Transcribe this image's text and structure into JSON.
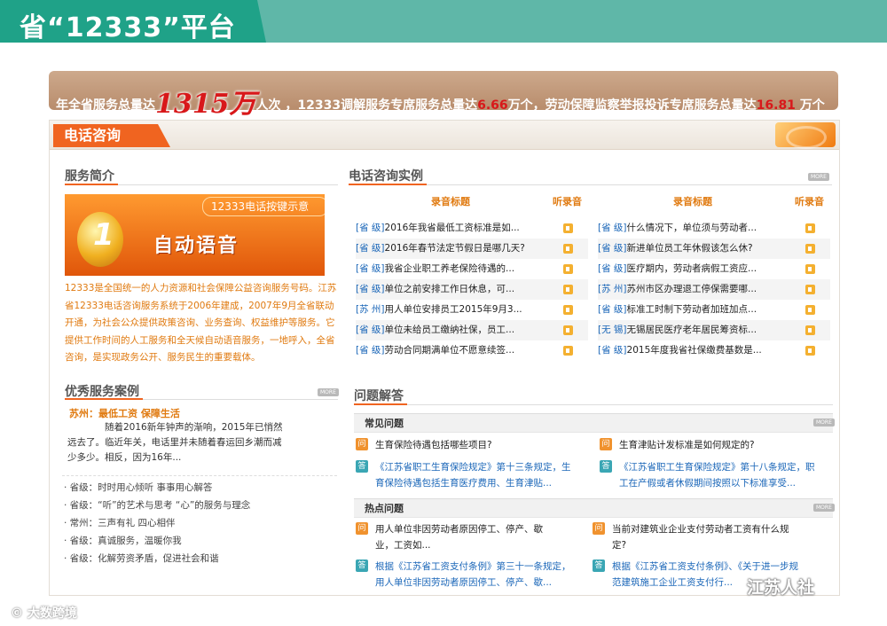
{
  "header": {
    "title": "省“12333”平台"
  },
  "stats": {
    "prefix": "年全省服务总量达",
    "total": "1315万",
    "part2": "人次 ，12333调解服务专席服务总量达",
    "mediation": "6.66",
    "part3": "万个，劳动保障监察举报投诉专席服务总量达",
    "complaints": "16.81",
    "part4": " 万个"
  },
  "panel": {
    "tab_label": "电话咨询"
  },
  "service_intro": {
    "title": "服务简介",
    "promo_top": "12333电话按键示意",
    "promo_main": "自动语音",
    "promo_number": "1",
    "text": "12333是全国统一的人力资源和社会保障公益咨询服务号码。江苏省12333电话咨询服务系统于2006年建成，2007年9月全省联动开通，为社会公众提供政策咨询、业务查询、权益维护等服务。它提供工作时间的人工服务和全天候自动语音服务，一地呼入，全省咨询，是实现政务公开、服务民生的重要载体。"
  },
  "cases": {
    "title": "优秀服务案例",
    "more": "MORE",
    "featured_title": "苏州：最低工资 保障生活",
    "featured_text": "随着2016新年钟声的渐响，2015年已悄然远去了。临近年关，电话里并未随着春运回乡潮而减少多少。相反，因为16年...",
    "items": [
      "· 省级：时时用心倾听 事事用心解答",
      "· 省级：“听”的艺术与思考 “心”的服务与理念",
      "· 常州：三声有礼 四心相伴",
      "· 省级：真诚服务，温暖你我",
      "· 省级：化解劳资矛盾，促进社会和谐"
    ]
  },
  "examples": {
    "title": "电话咨询实例",
    "more": "MORE",
    "col_title": "录音标题",
    "col_listen": "听录音",
    "left": [
      {
        "tag": "[省 级]",
        "text": "2016年我省最低工资标准是如..."
      },
      {
        "tag": "[省 级]",
        "text": "2016年春节法定节假日是哪几天?"
      },
      {
        "tag": "[省 级]",
        "text": "我省企业职工养老保险待遇的..."
      },
      {
        "tag": "[省 级]",
        "text": "单位之前安排工作日休息，可..."
      },
      {
        "tag": "[苏 州]",
        "text": "用人单位安排员工2015年9月3..."
      },
      {
        "tag": "[省 级]",
        "text": "单位未给员工缴纳社保，员工..."
      },
      {
        "tag": "[省 级]",
        "text": "劳动合同期满单位不愿意续签..."
      }
    ],
    "right": [
      {
        "tag": "[省 级]",
        "text": "什么情况下，单位须与劳动者..."
      },
      {
        "tag": "[省 级]",
        "text": "新进单位员工年休假该怎么休?"
      },
      {
        "tag": "[省 级]",
        "text": "医疗期内，劳动者病假工资应..."
      },
      {
        "tag": "[苏 州]",
        "text": "苏州市区办理退工停保需要哪..."
      },
      {
        "tag": "[省 级]",
        "text": "标准工时制下劳动者加班加点..."
      },
      {
        "tag": "[无 锡]",
        "text": "无锡居民医疗老年居民筹资标..."
      },
      {
        "tag": "[省 级]",
        "text": "2015年度我省社保缴费基数是..."
      }
    ]
  },
  "qa": {
    "title": "问题解答",
    "common_label": "常见问题",
    "hot_label": "热点问题",
    "more": "MORE",
    "q_badge": "问",
    "a_badge": "答",
    "common": [
      {
        "q": "生育保险待遇包括哪些项目?",
        "a1": "《江苏省职工生育保险规定》第十三条规定，生",
        "a2": "育保险待遇包括生育医疗费用、生育津贴..."
      },
      {
        "q": "生育津贴计发标准是如何规定的?",
        "a1": "《江苏省职工生育保险规定》第十八条规定，职",
        "a2": "工在产假或者休假期间按照以下标准享受..."
      }
    ],
    "hot": [
      {
        "q1": "用人单位非因劳动者原因停工、停产、歇",
        "q2": "业，工资如...",
        "a1": "根据《江苏省工资支付条例》第三十一条规定，",
        "a2": "用人单位非因劳动者原因停工、停产、歇..."
      },
      {
        "q1": "当前对建筑业企业支付劳动者工资有什么规",
        "q2": "定?",
        "a1": "根据《江苏省工资支付条例》、《关于进一步规",
        "a2": "范建筑施工企业工资支付行..."
      }
    ]
  },
  "watermarks": {
    "left": "© 大数跨境",
    "right": "江苏人社"
  }
}
